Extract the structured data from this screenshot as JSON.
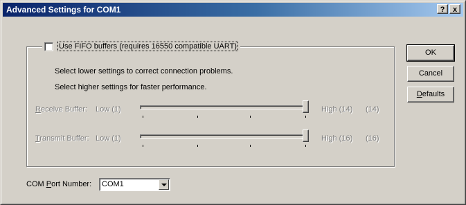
{
  "window": {
    "title": "Advanced Settings for COM1",
    "help_glyph": "?",
    "close_glyph": "x"
  },
  "fifo": {
    "label": "Use FIFO buffers (requires 16550 compatible UART)",
    "checked": false
  },
  "info": {
    "line1": "Select lower settings to correct connection problems.",
    "line2": "Select higher settings for faster performance."
  },
  "receive": {
    "label_mnemonic": "R",
    "label_rest": "eceive Buffer:",
    "low": "Low (1)",
    "high": "High (14)",
    "value": "(14)",
    "level": 1.0,
    "enabled": false
  },
  "transmit": {
    "label_mnemonic": "T",
    "label_rest": "ransmit Buffer:",
    "low": "Low (1)",
    "high": "High (16)",
    "value": "(16)",
    "level": 1.0,
    "enabled": false
  },
  "buttons": {
    "ok": "OK",
    "cancel": "Cancel",
    "defaults_mnemonic": "D",
    "defaults_rest": "efaults"
  },
  "com_port": {
    "label_pre": "COM ",
    "label_mnemonic": "P",
    "label_rest": "ort Number:",
    "value": "COM1"
  }
}
